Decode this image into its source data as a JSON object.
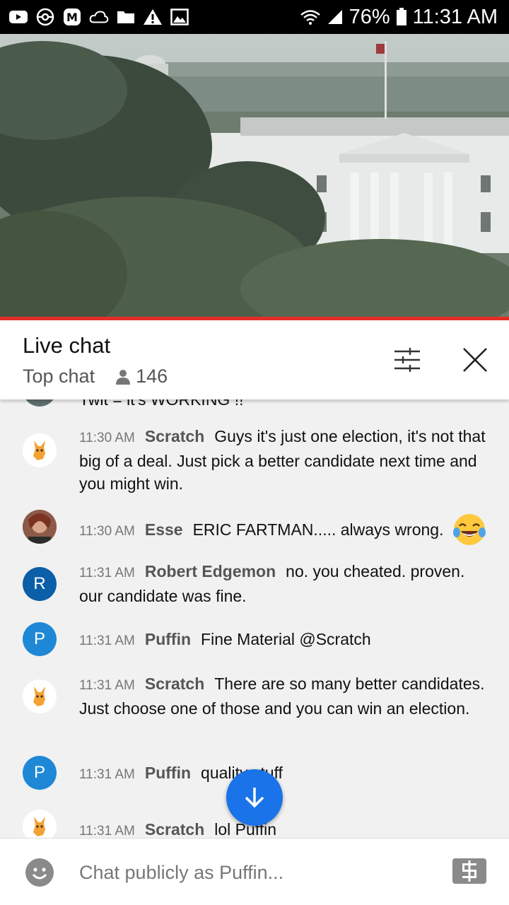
{
  "status_bar": {
    "battery": "76%",
    "time": "11:31 AM"
  },
  "video": {
    "description_icon": "white-house-livestream"
  },
  "chat": {
    "title": "Live chat",
    "mode": "Top chat",
    "viewer_count": "146",
    "messages": [
      {
        "partial": true,
        "text": "Twit = it's WORKING !!"
      },
      {
        "time": "11:30 AM",
        "author": "Scratch",
        "text": "Guys it's just one election, it's not that big of a deal. Just pick a better candidate next time and you might win.",
        "avatar": "scratch"
      },
      {
        "time": "11:30 AM",
        "author": "Esse",
        "text": "ERIC FARTMAN..... always wrong.",
        "avatar": "photo",
        "emoji": "laughing-crying-emoji"
      },
      {
        "time": "11:31 AM",
        "author": "Robert Edgemon",
        "text": "no. you cheated. proven. our candidate was fine.",
        "avatar": "R",
        "avatar_color": "#0b5ea8"
      },
      {
        "time": "11:31 AM",
        "author": "Puffin",
        "text": "Fine Material @Scratch",
        "avatar": "P",
        "avatar_color": "#1e88d6"
      },
      {
        "time": "11:31 AM",
        "author": "Scratch",
        "text": "There are so many better candidates. Just choose one of those and you can win an election.",
        "avatar": "scratch"
      },
      {
        "time": "11:31 AM",
        "author": "Puffin",
        "text": "quality stuff",
        "avatar": "P",
        "avatar_color": "#1e88d6"
      },
      {
        "time": "11:31 AM",
        "author": "Scratch",
        "text": "lol Puffin",
        "avatar": "scratch"
      }
    ]
  },
  "input": {
    "placeholder": "Chat publicly as Puffin..."
  },
  "colors": {
    "accent_blue": "#1a73e8",
    "progress_red": "#e52d27"
  }
}
